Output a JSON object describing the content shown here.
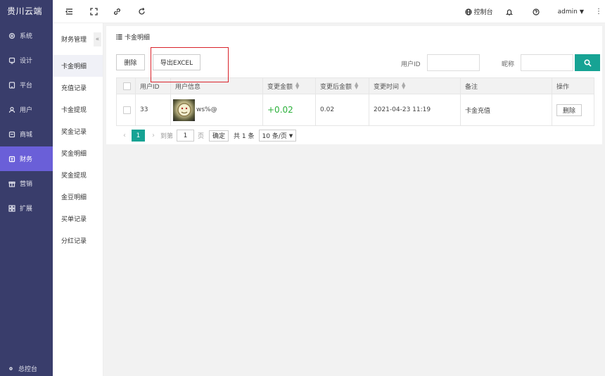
{
  "app": {
    "brand": "贵川云端"
  },
  "sidebar": {
    "items": [
      {
        "label": "系统",
        "icon": "settings-icon"
      },
      {
        "label": "设计",
        "icon": "monitor-icon"
      },
      {
        "label": "平台",
        "icon": "tablet-icon"
      },
      {
        "label": "用户",
        "icon": "user-icon"
      },
      {
        "label": "商城",
        "icon": "store-icon"
      },
      {
        "label": "财务",
        "icon": "finance-icon",
        "active": true
      },
      {
        "label": "营销",
        "icon": "gift-icon"
      },
      {
        "label": "扩展",
        "icon": "grid-icon"
      }
    ],
    "bottom_label": "总控台"
  },
  "topbar": {
    "control_panel": "控制台",
    "user": "admin"
  },
  "subnav": {
    "title": "财务管理",
    "collapse": "«",
    "items": [
      "卡金明细",
      "充值记录",
      "卡金提现",
      "奖金记录",
      "奖金明细",
      "奖金提现",
      "金豆明细",
      "买单记录",
      "分红记录"
    ],
    "active_index": 0
  },
  "card": {
    "title": "卡金明细",
    "delete_label": "删除",
    "export_label": "导出EXCEL",
    "search": {
      "userid_label": "用户ID",
      "nickname_label": "昵称"
    }
  },
  "table": {
    "headers": [
      "用户ID",
      "用户信息",
      "变更金额",
      "变更后金额",
      "变更时间",
      "备注",
      "操作"
    ],
    "rows": [
      {
        "user_id": "33",
        "nickname": "ws%@",
        "change": "+0.02",
        "after": "0.02",
        "time": "2021-04-23 11:19",
        "note": "卡金充值",
        "action": "删除"
      }
    ]
  },
  "pager": {
    "current": "1",
    "goto_label": "到第",
    "page_input": "1",
    "page_label": "页",
    "ok_label": "确定",
    "total": "共 1 条",
    "size": "10 条/页"
  },
  "colors": {
    "sidebar_bg": "#393d6b",
    "active": "#6a5fd8",
    "accent": "#17a394",
    "highlight_box": "#d9222a",
    "positive": "#2bb03a"
  }
}
